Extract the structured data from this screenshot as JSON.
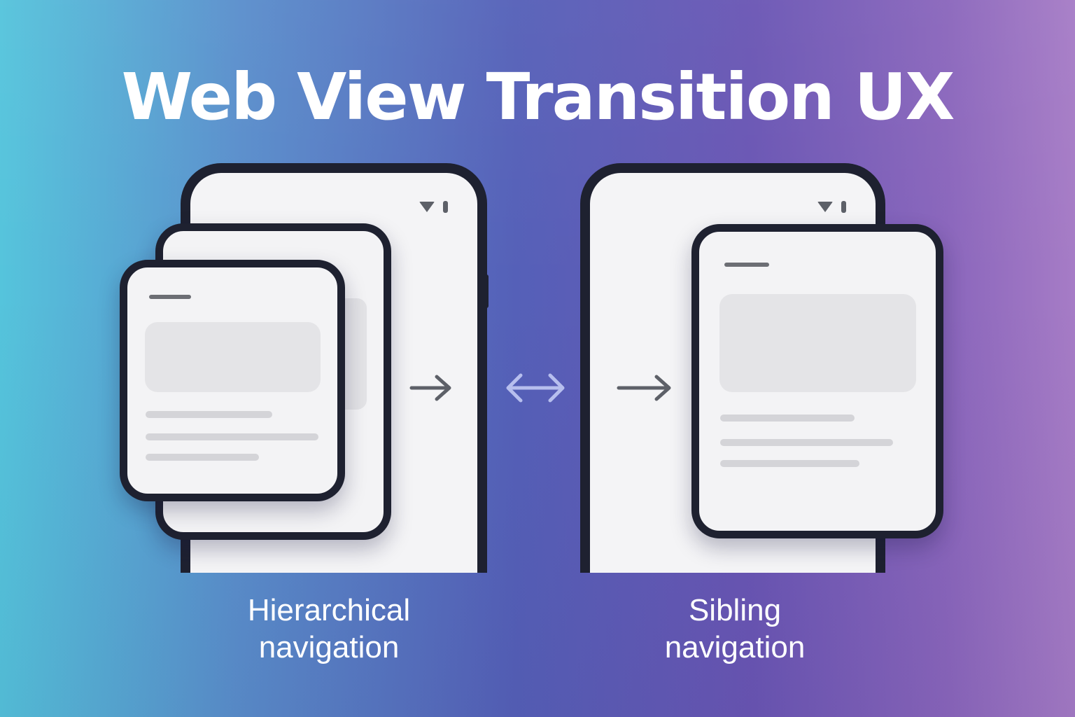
{
  "title": "Web View Transition UX",
  "diagram": {
    "left": {
      "label_line1": "Hierarchical",
      "label_line2": "navigation"
    },
    "right": {
      "label_line1": "Sibling",
      "label_line2": "navigation"
    }
  },
  "colors": {
    "phone_frame": "#1e2130",
    "screen": "#f4f4f6",
    "placeholder_block": "#e4e4e7",
    "text_line": "#d4d4d8",
    "arrow": "#5d6068",
    "double_arrow": "#b7bfee"
  },
  "icons": [
    "wifi-icon",
    "battery-icon",
    "arrow-right-icon",
    "double-arrow-icon"
  ]
}
